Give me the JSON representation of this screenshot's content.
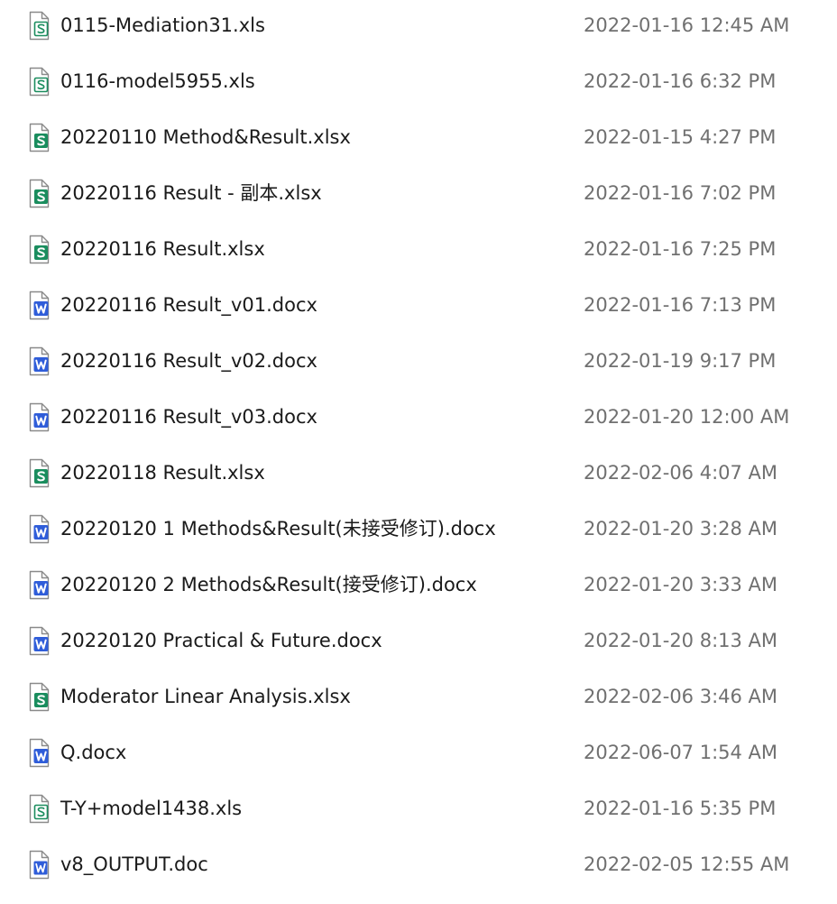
{
  "colors": {
    "sheet_green": "#1a8d5e",
    "word_blue": "#2f5dd9",
    "outline_gray": "#8a8a8a",
    "name_text": "#1a1a1a",
    "date_text": "#707070"
  },
  "files": [
    {
      "name": "0115-Mediation31.xls",
      "modified": "2022-01-16 12:45 AM",
      "icon": "xls-sheet-icon"
    },
    {
      "name": "0116-model5955.xls",
      "modified": "2022-01-16 6:32 PM",
      "icon": "xls-sheet-icon"
    },
    {
      "name": "20220110 Method&Result.xlsx",
      "modified": "2022-01-15 4:27 PM",
      "icon": "xlsx-sheet-icon"
    },
    {
      "name": "20220116 Result - 副本.xlsx",
      "modified": "2022-01-16 7:02 PM",
      "icon": "xlsx-sheet-icon"
    },
    {
      "name": "20220116 Result.xlsx",
      "modified": "2022-01-16 7:25 PM",
      "icon": "xlsx-sheet-icon"
    },
    {
      "name": "20220116 Result_v01.docx",
      "modified": "2022-01-16 7:13 PM",
      "icon": "word-doc-icon"
    },
    {
      "name": "20220116 Result_v02.docx",
      "modified": "2022-01-19 9:17 PM",
      "icon": "word-doc-icon"
    },
    {
      "name": "20220116 Result_v03.docx",
      "modified": "2022-01-20 12:00 AM",
      "icon": "word-doc-icon"
    },
    {
      "name": "20220118 Result.xlsx",
      "modified": "2022-02-06 4:07 AM",
      "icon": "xlsx-sheet-icon"
    },
    {
      "name": "20220120 1 Methods&Result(未接受修订).docx",
      "modified": "2022-01-20 3:28 AM",
      "icon": "word-doc-icon"
    },
    {
      "name": "20220120 2 Methods&Result(接受修订).docx",
      "modified": "2022-01-20 3:33 AM",
      "icon": "word-doc-icon"
    },
    {
      "name": "20220120 Practical & Future.docx",
      "modified": "2022-01-20 8:13 AM",
      "icon": "word-doc-icon"
    },
    {
      "name": "Moderator Linear Analysis.xlsx",
      "modified": "2022-02-06 3:46 AM",
      "icon": "xlsx-sheet-icon"
    },
    {
      "name": "Q.docx",
      "modified": "2022-06-07 1:54 AM",
      "icon": "word-doc-icon"
    },
    {
      "name": "T-Y+model1438.xls",
      "modified": "2022-01-16 5:35 PM",
      "icon": "xls-sheet-icon"
    },
    {
      "name": "v8_OUTPUT.doc",
      "modified": "2022-02-05 12:55 AM",
      "icon": "doc-word-icon"
    }
  ]
}
